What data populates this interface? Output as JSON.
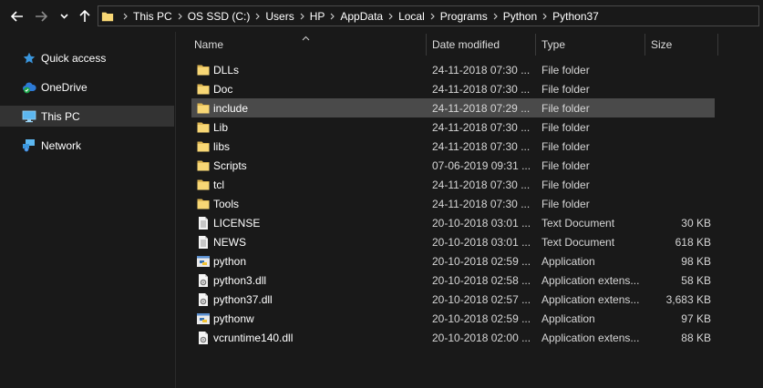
{
  "breadcrumb": [
    "This PC",
    "OS SSD (C:)",
    "Users",
    "HP",
    "AppData",
    "Local",
    "Programs",
    "Python",
    "Python37"
  ],
  "sidebar": {
    "items": [
      {
        "label": "Quick access",
        "icon": "star-icon"
      },
      {
        "label": "OneDrive",
        "icon": "onedrive-cloud-icon"
      },
      {
        "label": "This PC",
        "icon": "computer-icon"
      },
      {
        "label": "Network",
        "icon": "network-icon"
      }
    ]
  },
  "columns": {
    "name": "Name",
    "date": "Date modified",
    "type": "Type",
    "size": "Size"
  },
  "files": [
    {
      "name": "DLLs",
      "date": "24-11-2018 07:30 ...",
      "type": "File folder",
      "size": "",
      "icon": "folder-icon"
    },
    {
      "name": "Doc",
      "date": "24-11-2018 07:30 ...",
      "type": "File folder",
      "size": "",
      "icon": "folder-icon"
    },
    {
      "name": "include",
      "date": "24-11-2018 07:29 ...",
      "type": "File folder",
      "size": "",
      "icon": "folder-icon"
    },
    {
      "name": "Lib",
      "date": "24-11-2018 07:30 ...",
      "type": "File folder",
      "size": "",
      "icon": "folder-icon"
    },
    {
      "name": "libs",
      "date": "24-11-2018 07:30 ...",
      "type": "File folder",
      "size": "",
      "icon": "folder-icon"
    },
    {
      "name": "Scripts",
      "date": "07-06-2019 09:31 ...",
      "type": "File folder",
      "size": "",
      "icon": "folder-icon"
    },
    {
      "name": "tcl",
      "date": "24-11-2018 07:30 ...",
      "type": "File folder",
      "size": "",
      "icon": "folder-icon"
    },
    {
      "name": "Tools",
      "date": "24-11-2018 07:30 ...",
      "type": "File folder",
      "size": "",
      "icon": "folder-icon"
    },
    {
      "name": "LICENSE",
      "date": "20-10-2018 03:01 ...",
      "type": "Text Document",
      "size": "30 KB",
      "icon": "text-document-icon"
    },
    {
      "name": "NEWS",
      "date": "20-10-2018 03:01 ...",
      "type": "Text Document",
      "size": "618 KB",
      "icon": "text-document-icon"
    },
    {
      "name": "python",
      "date": "20-10-2018 02:59 ...",
      "type": "Application",
      "size": "98 KB",
      "icon": "python-app-icon"
    },
    {
      "name": "python3.dll",
      "date": "20-10-2018 02:58 ...",
      "type": "Application extens...",
      "size": "58 KB",
      "icon": "dll-icon"
    },
    {
      "name": "python37.dll",
      "date": "20-10-2018 02:57 ...",
      "type": "Application extens...",
      "size": "3,683 KB",
      "icon": "dll-icon"
    },
    {
      "name": "pythonw",
      "date": "20-10-2018 02:59 ...",
      "type": "Application",
      "size": "97 KB",
      "icon": "python-app-icon"
    },
    {
      "name": "vcruntime140.dll",
      "date": "20-10-2018 02:00 ...",
      "type": "Application extens...",
      "size": "88 KB",
      "icon": "dll-icon"
    }
  ],
  "colors": {
    "background": "#191919",
    "selected_row": "#4a4a4a",
    "selected_nav": "#333333",
    "folder": "#f8d775"
  }
}
